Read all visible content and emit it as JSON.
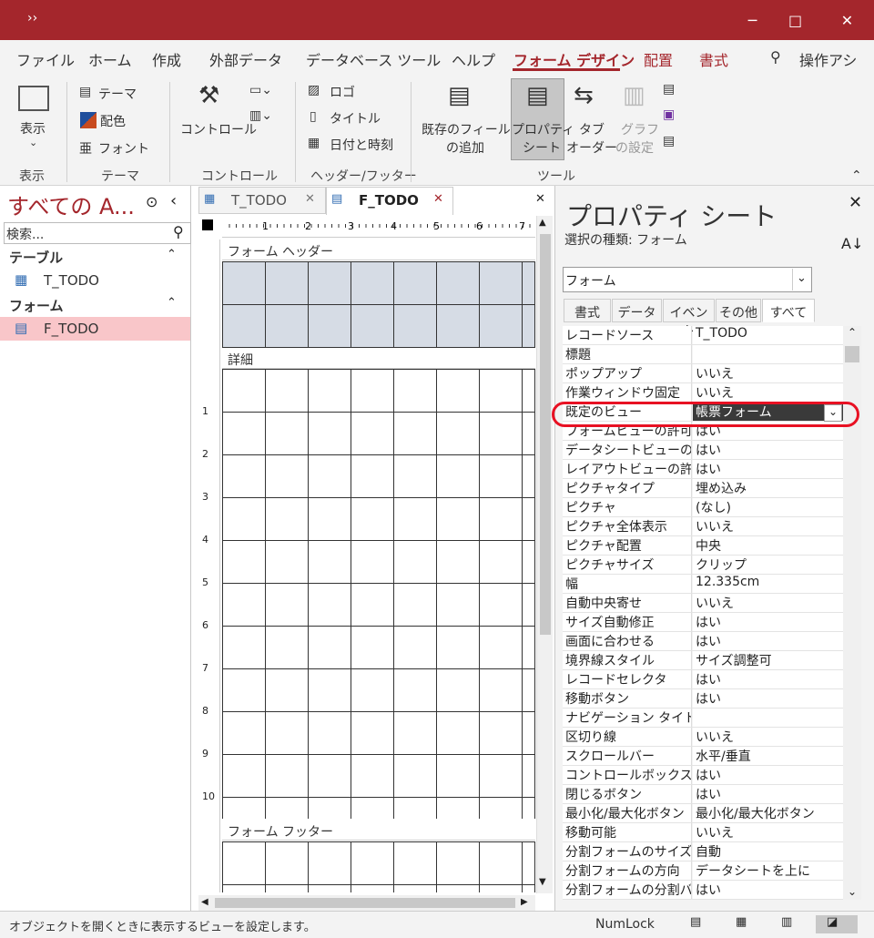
{
  "titlebar": {
    "overflow": "››"
  },
  "window": {
    "minimize": "─",
    "maximize": "□",
    "close": "✕"
  },
  "menu": {
    "tabs": [
      "ファイル",
      "ホーム",
      "作成",
      "外部データ",
      "データベース ツール",
      "ヘルプ",
      "フォーム デザイン",
      "配置",
      "書式"
    ],
    "search_label": "操作アシ"
  },
  "ribbon": {
    "view": "表示",
    "theme": "テーマ",
    "colors": "配色",
    "fonts": "フォント",
    "controls": "コントロール",
    "logo": "ロゴ",
    "title": "タイトル",
    "datetime": "日付と時刻",
    "add_field_1": "既存のフィールド",
    "add_field_2": "の追加",
    "prop_1": "プロパティ",
    "prop_2": "シート",
    "tab_1": "タブ",
    "tab_2": "オーダー",
    "chart_1": "グラフ",
    "chart_2": "の設定",
    "groups": {
      "view": "表示",
      "theme": "テーマ",
      "controls": "コントロール",
      "headerfooter": "ヘッダー/フッター",
      "tools": "ツール"
    }
  },
  "nav": {
    "title": "すべての A...",
    "search_placeholder": "検索...",
    "sections": [
      {
        "label": "テーブル",
        "items": [
          "T_TODO"
        ]
      },
      {
        "label": "フォーム",
        "items": [
          "F_TODO"
        ]
      }
    ]
  },
  "doc": {
    "tabs": [
      "T_TODO",
      "F_TODO"
    ],
    "sections": {
      "header": "フォーム ヘッダー",
      "detail": "詳細",
      "footer": "フォーム フッター"
    },
    "ruler_marks": [
      "1",
      "2",
      "3",
      "4",
      "5",
      "6",
      "7"
    ],
    "vruler_marks": [
      "1",
      "2",
      "3",
      "4",
      "5",
      "6",
      "7",
      "8",
      "9",
      "10"
    ]
  },
  "property_sheet": {
    "title": "プロパティ シート",
    "selection_label": "選択の種類: フォーム",
    "selected_object": "フォーム",
    "tabs": [
      "書式",
      "データ",
      "イベント",
      "その他",
      "すべて"
    ],
    "rows": [
      {
        "name": "レコードソース",
        "value": "T_TODO"
      },
      {
        "name": "標題",
        "value": ""
      },
      {
        "name": "ポップアップ",
        "value": "いいえ"
      },
      {
        "name": "作業ウィンドウ固定",
        "value": "いいえ"
      },
      {
        "name": "既定のビュー",
        "value": "帳票フォーム"
      },
      {
        "name": "フォームビューの許可",
        "value": "はい"
      },
      {
        "name": "データシートビューの許可",
        "value": "はい"
      },
      {
        "name": "レイアウトビューの許可",
        "value": "はい"
      },
      {
        "name": "ピクチャタイプ",
        "value": "埋め込み"
      },
      {
        "name": "ピクチャ",
        "value": "(なし)"
      },
      {
        "name": "ピクチャ全体表示",
        "value": "いいえ"
      },
      {
        "name": "ピクチャ配置",
        "value": "中央"
      },
      {
        "name": "ピクチャサイズ",
        "value": "クリップ"
      },
      {
        "name": "幅",
        "value": "12.335cm"
      },
      {
        "name": "自動中央寄せ",
        "value": "いいえ"
      },
      {
        "name": "サイズ自動修正",
        "value": "はい"
      },
      {
        "name": "画面に合わせる",
        "value": "はい"
      },
      {
        "name": "境界線スタイル",
        "value": "サイズ調整可"
      },
      {
        "name": "レコードセレクタ",
        "value": "はい"
      },
      {
        "name": "移動ボタン",
        "value": "はい"
      },
      {
        "name": "ナビゲーション タイトル",
        "value": ""
      },
      {
        "name": "区切り線",
        "value": "いいえ"
      },
      {
        "name": "スクロールバー",
        "value": "水平/垂直"
      },
      {
        "name": "コントロールボックス",
        "value": "はい"
      },
      {
        "name": "閉じるボタン",
        "value": "はい"
      },
      {
        "name": "最小化/最大化ボタン",
        "value": "最小化/最大化ボタン"
      },
      {
        "name": "移動可能",
        "value": "いいえ"
      },
      {
        "name": "分割フォームのサイズ",
        "value": "自動"
      },
      {
        "name": "分割フォームの方向",
        "value": "データシートを上に"
      },
      {
        "name": "分割フォームの分割バー",
        "value": "はい"
      }
    ]
  },
  "status": {
    "text": "オブジェクトを開くときに表示するビューを設定します。",
    "numlock": "NumLock"
  }
}
